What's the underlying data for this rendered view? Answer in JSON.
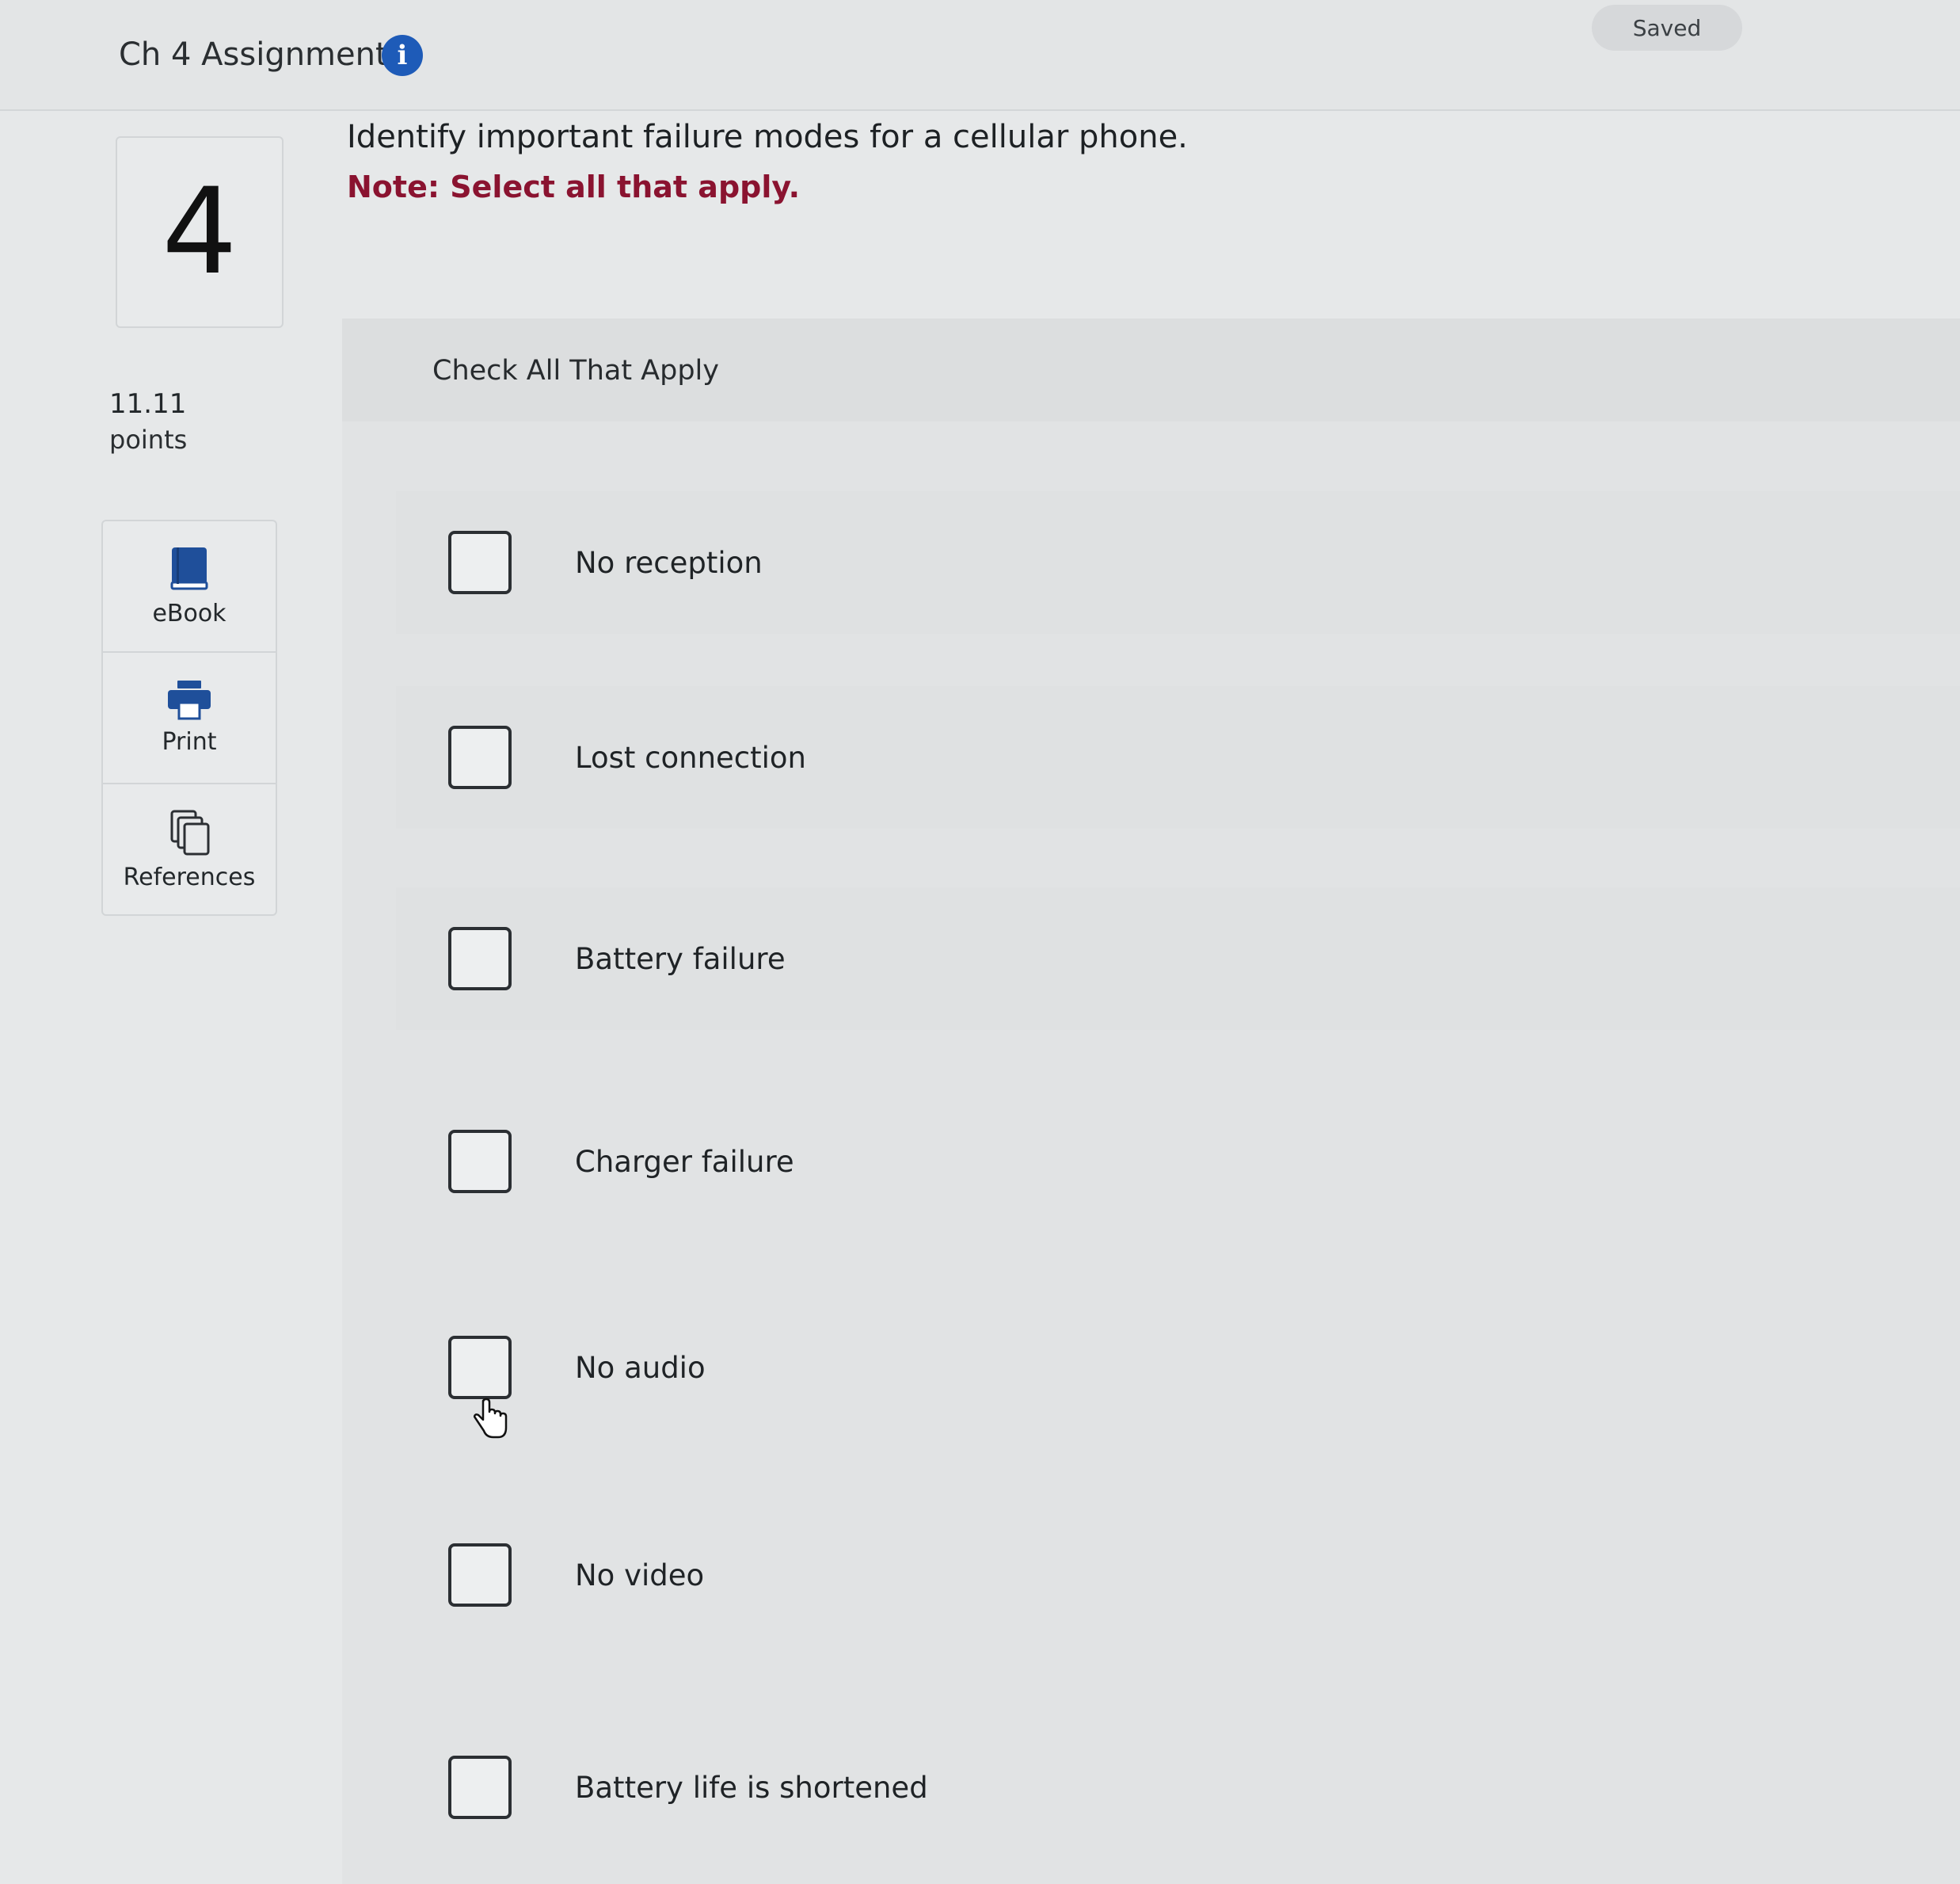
{
  "header": {
    "assignment_title": "Ch 4 Assignment",
    "info_icon": "info-icon",
    "saved_status": "Saved"
  },
  "question": {
    "number": "4",
    "points_value": "11.11",
    "points_label": "points",
    "prompt": "Identify important failure modes for a cellular phone.",
    "note": "Note: Select all that apply.",
    "instruction": "Check All That Apply",
    "options": [
      {
        "label": "No reception",
        "checked": false
      },
      {
        "label": "Lost connection",
        "checked": false
      },
      {
        "label": "Battery failure",
        "checked": false
      },
      {
        "label": "Charger failure",
        "checked": false
      },
      {
        "label": "No audio",
        "checked": false
      },
      {
        "label": "No video",
        "checked": false
      },
      {
        "label": "Battery life is shortened",
        "checked": false
      }
    ]
  },
  "tools": [
    {
      "label": "eBook",
      "icon": "book-icon"
    },
    {
      "label": "Print",
      "icon": "printer-icon"
    },
    {
      "label": "References",
      "icon": "copy-icon"
    }
  ],
  "colors": {
    "accent_blue": "#1e5bb8",
    "note_red": "#8a1330",
    "tool_icon_blue": "#1f4f9a"
  }
}
